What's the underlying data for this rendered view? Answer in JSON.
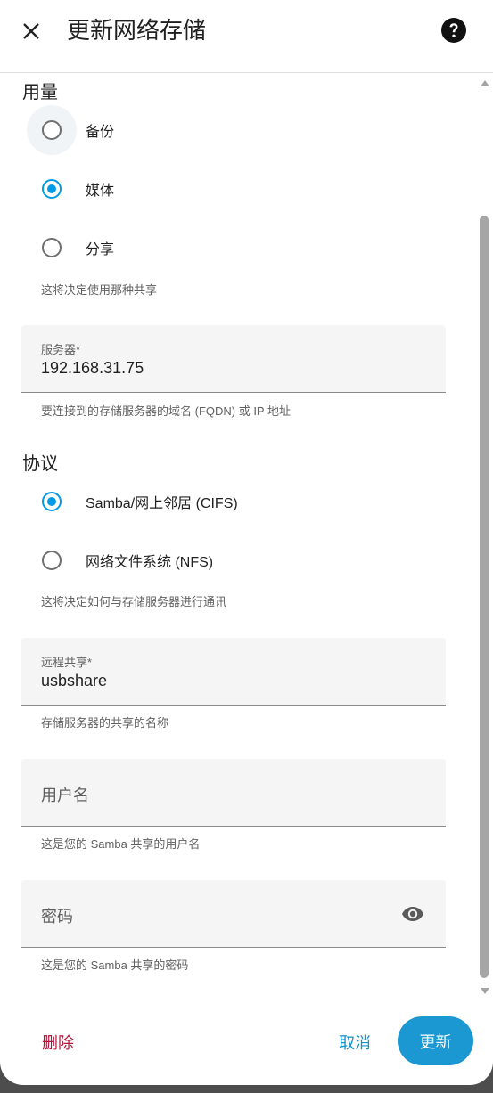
{
  "dialog": {
    "title": "更新网络存储",
    "close_icon": "close-icon",
    "help_icon": "help-circle-icon"
  },
  "usage": {
    "label": "用量",
    "options": [
      {
        "label": "备份",
        "checked": false,
        "focused": true
      },
      {
        "label": "媒体",
        "checked": true,
        "focused": false
      },
      {
        "label": "分享",
        "checked": false,
        "focused": false
      }
    ],
    "helper": "这将决定使用那种共享"
  },
  "server": {
    "label": "服务器*",
    "value": "192.168.31.75",
    "helper": "要连接到的存储服务器的域名 (FQDN) 或 IP 地址"
  },
  "protocol": {
    "label": "协议",
    "options": [
      {
        "label": "Samba/网上邻居 (CIFS)",
        "checked": true
      },
      {
        "label": "网络文件系统 (NFS)",
        "checked": false
      }
    ],
    "helper": "这将决定如何与存储服务器进行通讯"
  },
  "remote_share": {
    "label": "远程共享*",
    "value": "usbshare",
    "helper": "存储服务器的共享的名称"
  },
  "username": {
    "placeholder": "用户名",
    "helper": "这是您的 Samba 共享的用户名"
  },
  "password": {
    "placeholder": "密码",
    "helper": "这是您的 Samba 共享的密码",
    "toggle_icon": "eye-icon"
  },
  "footer": {
    "delete_label": "删除",
    "cancel_label": "取消",
    "update_label": "更新"
  },
  "colors": {
    "accent": "#039be5",
    "danger": "#b3163b",
    "primary_button": "#1b98d1"
  }
}
